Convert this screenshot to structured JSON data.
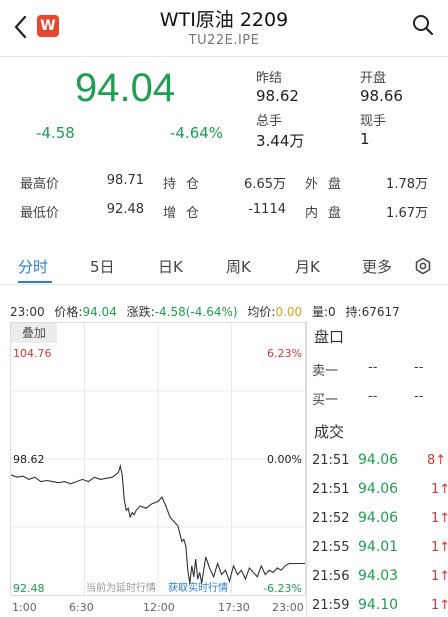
{
  "header": {
    "title": "WTI原油 2209",
    "subtitle": "TU22E.IPE",
    "logo_letter": "W"
  },
  "quote": {
    "price": "94.04",
    "change": "-4.58",
    "change_pct": "-4.64%",
    "prev_close_label": "昨结",
    "prev_close": "98.62",
    "open_label": "开盘",
    "open": "98.66",
    "volume_label": "总手",
    "volume": "3.44万",
    "current_hand_label": "现手",
    "current_hand": "1"
  },
  "stats": {
    "high_label": "最高价",
    "high": "98.71",
    "low_label": "最低价",
    "low": "92.48",
    "position_label": "持仓",
    "position": "6.65万",
    "increase_label": "增仓",
    "increase": "-1114",
    "outer_label": "外盘",
    "outer": "1.78万",
    "inner_label": "内盘",
    "inner": "1.67万"
  },
  "tabs": [
    "分时",
    "5日",
    "日K",
    "周K",
    "月K",
    "更多"
  ],
  "info": {
    "time": "23:00",
    "price_label": "价格:",
    "price": "94.04",
    "change_label": "涨跌:",
    "change": "-4.58(-4.64%)",
    "avg_label": "均价:",
    "avg": "0.00",
    "vol_label": "量:",
    "vol": "0",
    "hold_label": "持:",
    "hold": "67617"
  },
  "chart": {
    "overlay_label": "叠加",
    "y_top": "104.76",
    "y_mid": "98.62",
    "y_bottom": "92.48",
    "pct_top": "6.23%",
    "pct_mid": "0.00%",
    "pct_bottom": "-6.23%",
    "delay_note": "当前为延时行情",
    "realtime_link": "获取实时行情",
    "x_ticks": [
      "1:00",
      "6:30",
      "12:00",
      "17:30",
      "23:00"
    ]
  },
  "chart_data": {
    "type": "line",
    "ylim": [
      92.48,
      104.76
    ],
    "x": [
      0,
      6,
      12,
      18,
      24,
      30,
      36,
      42,
      48,
      54,
      60,
      66,
      72,
      78,
      84,
      90,
      96,
      102,
      108,
      110,
      112,
      114,
      116,
      118,
      120,
      122,
      124,
      126,
      130,
      136,
      142,
      148,
      152,
      156,
      160,
      164,
      168,
      172,
      174,
      176,
      178,
      180,
      182,
      184,
      186,
      188,
      190,
      192,
      196,
      200,
      204,
      208,
      212,
      216,
      220,
      224,
      228,
      232,
      236,
      240,
      244,
      248,
      252,
      256,
      260,
      264,
      268,
      272,
      276,
      280,
      284,
      288,
      292,
      296
    ],
    "values": [
      97.9,
      97.8,
      97.85,
      97.7,
      97.8,
      97.6,
      97.65,
      97.6,
      97.55,
      97.6,
      97.5,
      97.6,
      97.7,
      97.6,
      97.8,
      97.7,
      97.75,
      97.8,
      98.0,
      98.3,
      97.9,
      96.8,
      96.3,
      96.4,
      96.0,
      96.2,
      96.1,
      96.3,
      96.5,
      96.4,
      96.6,
      96.7,
      96.9,
      96.5,
      96.0,
      95.8,
      95.6,
      94.9,
      95.0,
      94.7,
      93.6,
      93.0,
      93.8,
      93.3,
      94.1,
      93.2,
      93.5,
      93.0,
      94.2,
      93.7,
      93.3,
      93.9,
      93.4,
      93.6,
      93.1,
      93.8,
      93.4,
      93.6,
      93.2,
      93.7,
      93.5,
      93.3,
      93.8,
      93.4,
      93.6,
      93.5,
      93.7,
      93.6,
      93.8,
      93.9,
      93.9,
      93.9,
      93.9,
      93.9
    ]
  },
  "orderbook": {
    "title": "盘口",
    "sell1_label": "卖一",
    "sell1_price": "--",
    "sell1_vol": "--",
    "buy1_label": "买一",
    "buy1_price": "--",
    "buy1_vol": "--"
  },
  "trades": {
    "title": "成交",
    "rows": [
      {
        "time": "21:51",
        "price": "94.06",
        "vol": "8↑"
      },
      {
        "time": "21:51",
        "price": "94.06",
        "vol": "1↑"
      },
      {
        "time": "21:52",
        "price": "94.06",
        "vol": "1↑"
      },
      {
        "time": "21:55",
        "price": "94.01",
        "vol": "1↑"
      },
      {
        "time": "21:56",
        "price": "94.03",
        "vol": "1↑"
      },
      {
        "time": "21:59",
        "price": "94.10",
        "vol": "1↑"
      }
    ]
  },
  "colors": {
    "up": "#d23a3a",
    "down": "#1e9e52",
    "accent": "#2a7fd4",
    "brand": "#e8462e"
  }
}
